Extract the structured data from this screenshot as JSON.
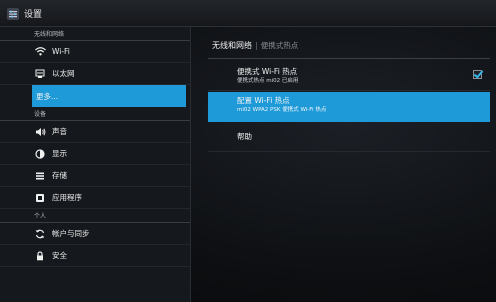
{
  "app": {
    "title": "设置",
    "icon": "settings-app-icon"
  },
  "sidebar": {
    "sections": [
      {
        "header": "无线和网络",
        "items": [
          {
            "label": "Wi-Fi",
            "icon": "wifi-icon"
          },
          {
            "label": "以太网",
            "icon": "ethernet-icon"
          },
          {
            "label": "更多...",
            "icon": "",
            "selected": true
          }
        ]
      },
      {
        "header": "设备",
        "items": [
          {
            "label": "声音",
            "icon": "sound-icon"
          },
          {
            "label": "显示",
            "icon": "display-icon"
          },
          {
            "label": "存储",
            "icon": "storage-icon"
          },
          {
            "label": "应用程序",
            "icon": "apps-icon"
          }
        ]
      },
      {
        "header": "个人",
        "items": [
          {
            "label": "帐户与同步",
            "icon": "sync-icon"
          },
          {
            "label": "安全",
            "icon": "lock-icon"
          }
        ]
      }
    ]
  },
  "main": {
    "breadcrumb": {
      "parent": "无线和网络",
      "current": "便携式热点"
    },
    "prefs": [
      {
        "title": "便携式 Wi-Fi 热点",
        "summary": "便携式热点 mi02 已启用",
        "checked": true
      },
      {
        "title": "配置 Wi-Fi 热点",
        "summary": "mi02 WPA2 PSK 便携式 Wi-Fi 热点",
        "selected": true
      },
      {
        "title": "帮助",
        "summary": ""
      }
    ]
  },
  "colors": {
    "accent": "#1e9ad8",
    "check": "#33b5e5",
    "background": "#0d0f12"
  }
}
